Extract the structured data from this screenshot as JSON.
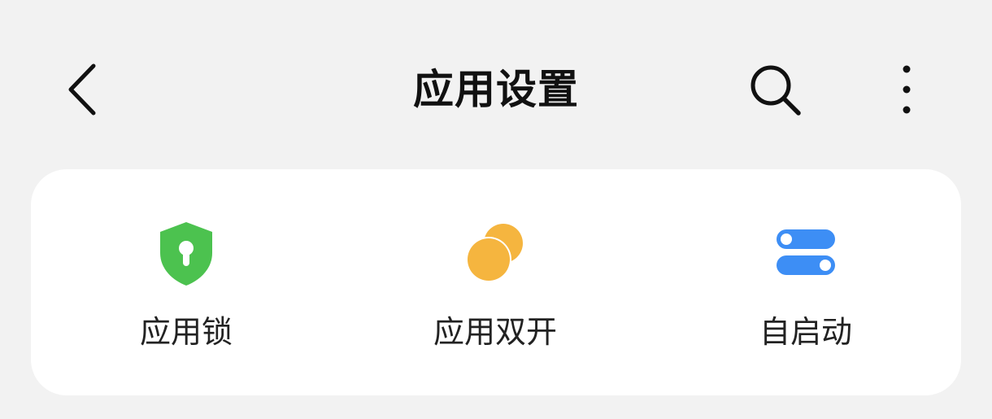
{
  "header": {
    "title": "应用设置",
    "back_icon": "chevron-left-icon",
    "search_icon": "search-icon",
    "more_icon": "more-vertical-icon"
  },
  "features": [
    {
      "label": "应用锁",
      "icon": "shield-lock-icon",
      "color": "#4cc24f"
    },
    {
      "label": "应用双开",
      "icon": "dual-circles-icon",
      "color": "#f5b53f"
    },
    {
      "label": "自启动",
      "icon": "toggle-switches-icon",
      "color": "#3d8ef5"
    }
  ],
  "colors": {
    "background": "#f2f2f2",
    "card": "#ffffff",
    "text": "#111111"
  }
}
